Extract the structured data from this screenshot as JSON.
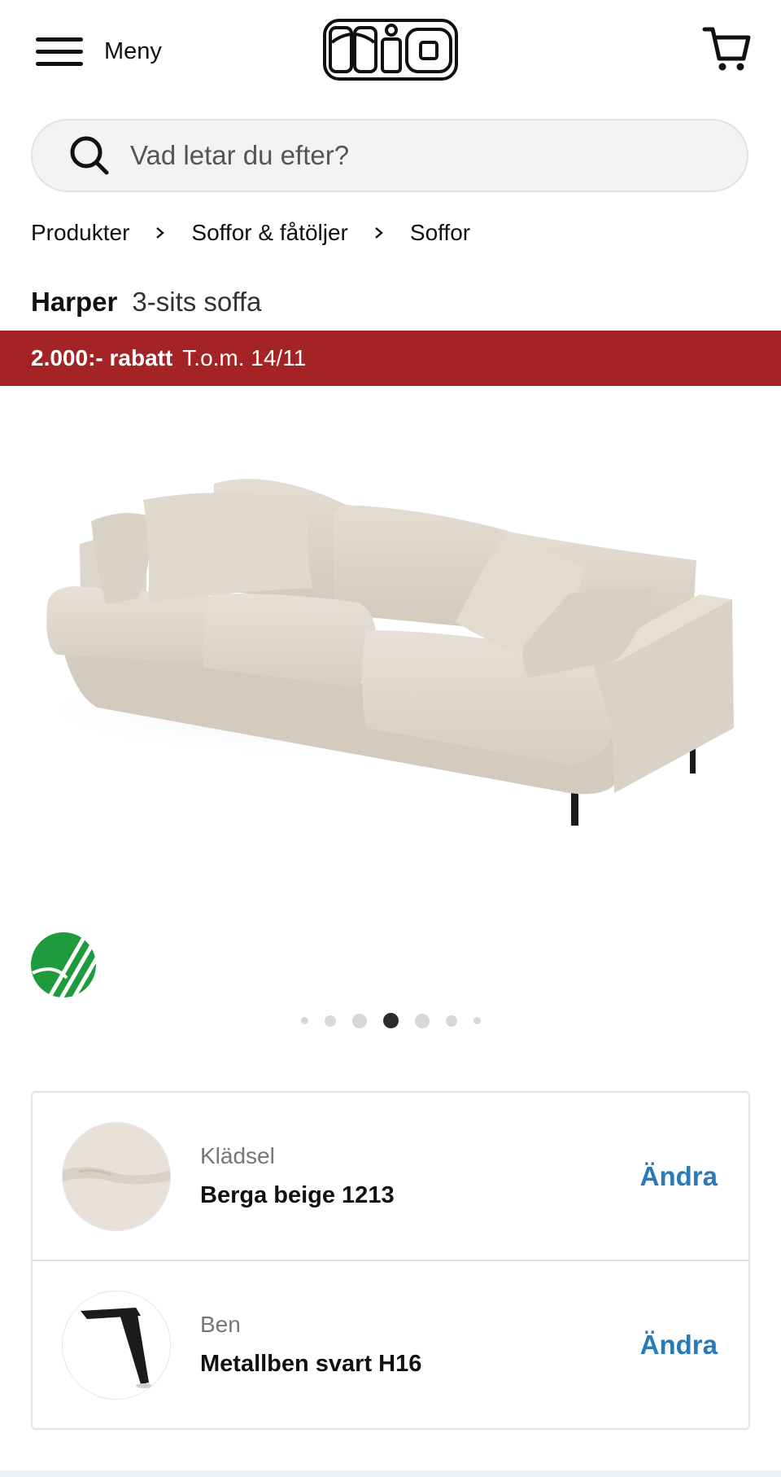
{
  "header": {
    "menu_label": "Meny",
    "logo_text": "mio",
    "cart_icon": "cart-icon"
  },
  "search": {
    "placeholder": "Vad letar du efter?"
  },
  "breadcrumb": [
    "Produkter",
    "Soffor & fåtöljer",
    "Soffor"
  ],
  "product": {
    "name": "Harper",
    "type": "3-sits soffa"
  },
  "promo": {
    "discount": "2.000:- rabatt",
    "valid_until": "T.o.m. 14/11",
    "color": "#a42325"
  },
  "gallery": {
    "dot_count": 7,
    "active_index": 3
  },
  "options": [
    {
      "label": "Klädsel",
      "value": "Berga beige 1213",
      "action": "Ändra"
    },
    {
      "label": "Ben",
      "value": "Metallben svart H16",
      "action": "Ändra"
    }
  ],
  "colors": {
    "accent_link": "#2a7ab8",
    "ecolabel_green": "#1f9a3c"
  }
}
